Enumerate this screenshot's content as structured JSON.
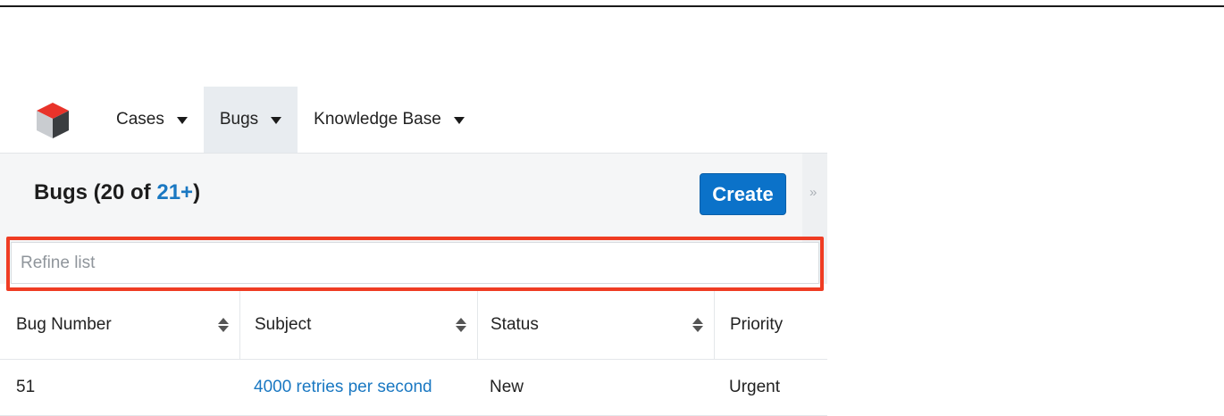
{
  "nav": {
    "items": [
      {
        "label": "Cases",
        "active": false
      },
      {
        "label": "Bugs",
        "active": true
      },
      {
        "label": "Knowledge Base",
        "active": false
      }
    ]
  },
  "list": {
    "title_prefix": "Bugs (20 of ",
    "count_link": "21+",
    "title_suffix": ")",
    "create_label": "Create",
    "toggle_glyph": "»"
  },
  "search": {
    "placeholder": "Refine list",
    "value": ""
  },
  "table": {
    "columns": [
      "Bug Number",
      "Subject",
      "Status",
      "Priority"
    ],
    "rows": [
      [
        "51",
        "4000 retries per second",
        "New",
        "Urgent"
      ]
    ]
  },
  "colors": {
    "accent": "#0b72c9",
    "link": "#1a78c2",
    "highlight": "#ef3c23",
    "active_tab": "#e8ecf0"
  },
  "icons": {
    "logo": "sugar-cube-logo",
    "nav_caret": "caret-down-icon",
    "sort": "sort-icon",
    "toggle": "double-chevron-right-icon"
  }
}
